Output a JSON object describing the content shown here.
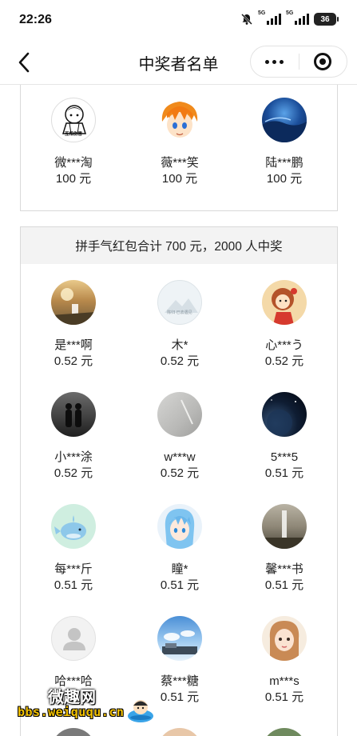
{
  "status_bar": {
    "time": "22:26",
    "net_tag_1": "5G",
    "net_tag_2": "5G",
    "battery": "36"
  },
  "nav": {
    "title": "中奖者名单"
  },
  "top_group": {
    "winners": [
      {
        "name": "微***淘",
        "amount": "100 元",
        "avatar_text": "互相伤害"
      },
      {
        "name": "薇***笑",
        "amount": "100 元"
      },
      {
        "name": "陆***鹏",
        "amount": "100 元"
      }
    ]
  },
  "main_group": {
    "header": "拼手气红包合计 700 元，2000 人中奖",
    "winners": [
      {
        "name": "是***啊",
        "amount": "0.52 元"
      },
      {
        "name": "木*",
        "amount": "0.52 元",
        "avatar_text": "陈归 已去遇见"
      },
      {
        "name": "心***う",
        "amount": "0.52 元"
      },
      {
        "name": "小***涂",
        "amount": "0.52 元"
      },
      {
        "name": "w***w",
        "amount": "0.52 元"
      },
      {
        "name": "5***5",
        "amount": "0.51 元"
      },
      {
        "name": "每***斤",
        "amount": "0.51 元"
      },
      {
        "name": "瞳*",
        "amount": "0.51 元"
      },
      {
        "name": "馨***书",
        "amount": "0.51 元"
      },
      {
        "name": "哈***哈",
        "amount": "0.51 元"
      },
      {
        "name": "蔡***糖",
        "amount": "0.51 元"
      },
      {
        "name": "m***s",
        "amount": "0.51 元"
      }
    ]
  },
  "watermark": {
    "title": "微趣网",
    "url": "bbs.weiququ.cn"
  },
  "colors": {
    "header_bg": "#f3f3f3",
    "border": "#d9d9d9",
    "watermark_url": "#f5c400"
  }
}
